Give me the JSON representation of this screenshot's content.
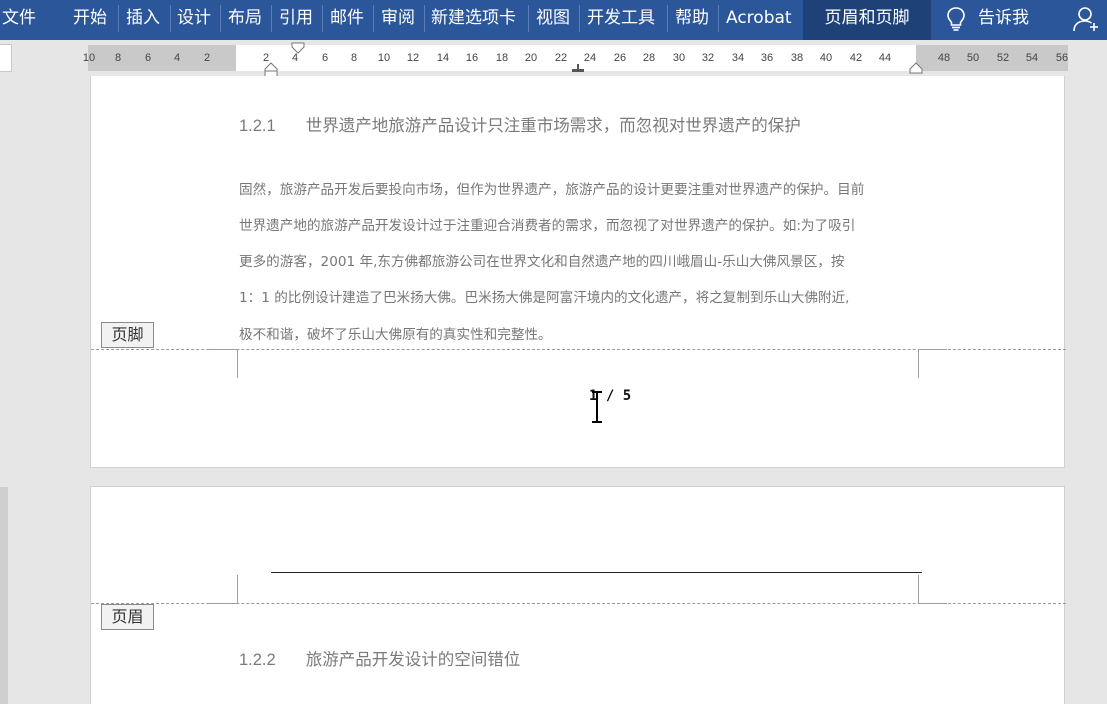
{
  "ribbon": {
    "tabs": [
      "文件",
      "开始",
      "插入",
      "设计",
      "布局",
      "引用",
      "邮件",
      "审阅",
      "新建选项卡",
      "视图",
      "开发工具",
      "帮助",
      "Acrobat"
    ],
    "context_tab": "页眉和页脚",
    "tell_me": "告诉我",
    "tell_me_icon": "lightbulb-icon",
    "user_icon": "add-user-icon",
    "colors": {
      "ribbon": "#2b579a",
      "context": "#1e4178"
    }
  },
  "ruler": {
    "left_numbers": [
      "10",
      "8",
      "6",
      "4",
      "2"
    ],
    "main_numbers": [
      "2",
      "4",
      "6",
      "8",
      "10",
      "12",
      "14",
      "16",
      "18",
      "20",
      "22",
      "24",
      "26",
      "28",
      "30",
      "32",
      "34",
      "36",
      "38",
      "40",
      "42",
      "44"
    ],
    "right_numbers": [
      "48",
      "50",
      "52",
      "54",
      "56"
    ]
  },
  "page1": {
    "heading_num": "1.2.1",
    "heading_text": "世界遗产地旅游产品设计只注重市场需求，而忽视对世界遗产的保护",
    "paragraph_lines": [
      "固然，旅游产品开发后要投向市场，但作为世界遗产，旅游产品的设计更要注重对世界遗产的保护。目前",
      "世界遗产地的旅游产品开发设计过于注重迎合消费者的需求，而忽视了对世界遗产的保护。如:为了吸引",
      "更多的游客，2001 年,东方佛都旅游公司在世界文化和自然遗产地的四川峨眉山-乐山大佛风景区，按",
      "1：1 的比例设计建造了巴米扬大佛。巴米扬大佛是阿富汗境内的文化遗产，将之复制到乐山大佛附近,",
      "极不和谐，破坏了乐山大佛原有的真实性和完整性。"
    ],
    "footer_label": "页脚",
    "page_number": "1 / 5"
  },
  "page2": {
    "header_label": "页眉",
    "heading_num": "1.2.2",
    "heading_text": "旅游产品开发设计的空间错位"
  }
}
